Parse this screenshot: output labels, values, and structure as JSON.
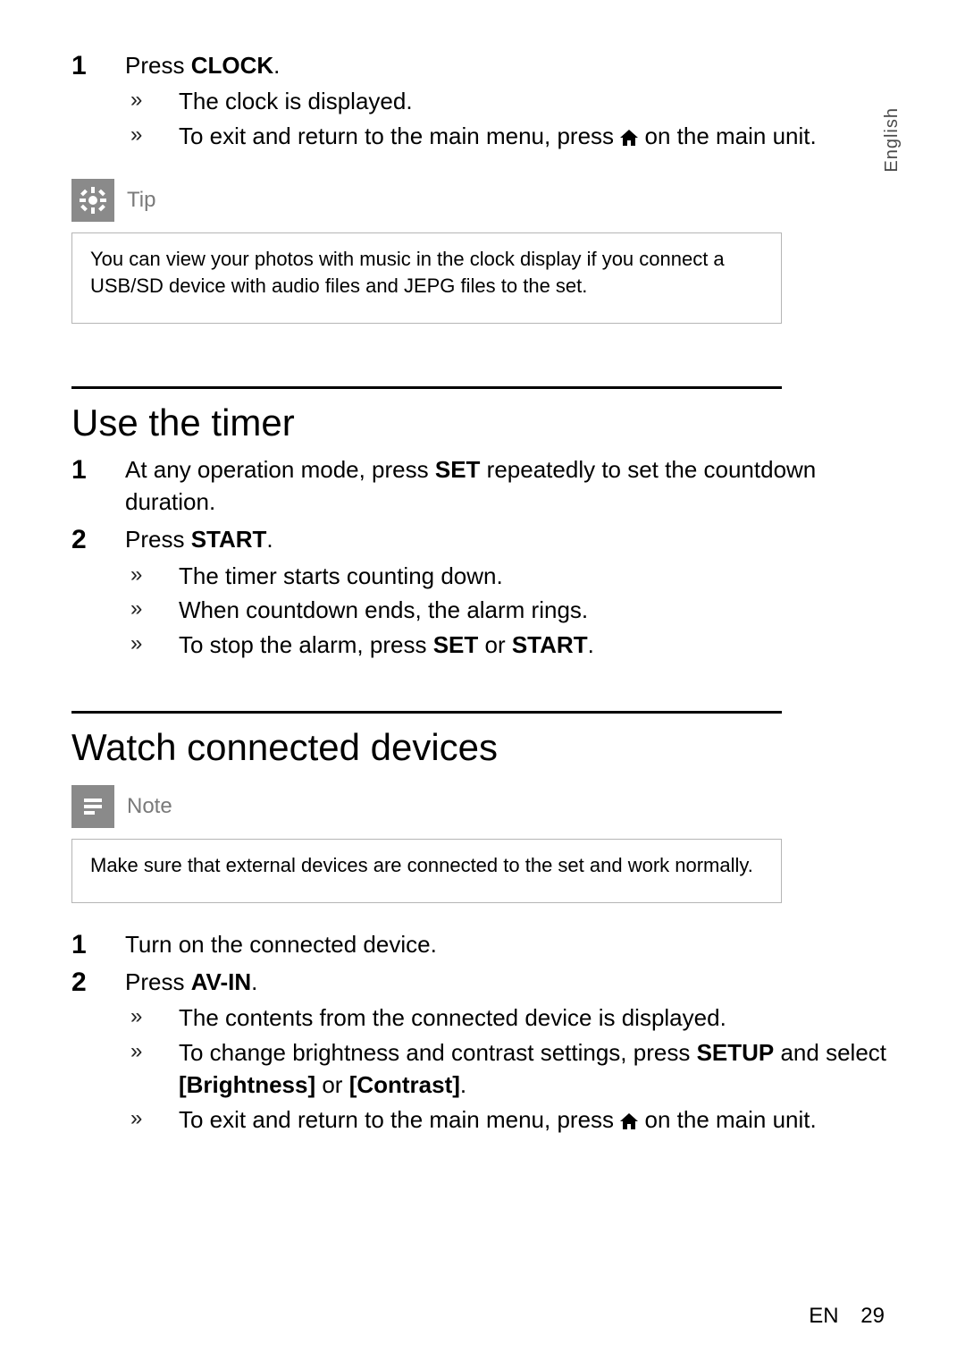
{
  "language_tab": "English",
  "section1": {
    "step1_num": "1",
    "step1_prefix": "Press ",
    "step1_key": "CLOCK",
    "step1_suffix": ".",
    "result1": "The clock is displayed.",
    "result2_a": "To exit and return to the main menu, press ",
    "result2_b": " on the main unit."
  },
  "tip": {
    "label": "Tip",
    "body": "You can view your photos with music in the clock display if you connect a USB/SD device with audio ﬁles and JEPG ﬁles to the set."
  },
  "timer": {
    "heading": "Use the timer",
    "step1_num": "1",
    "step1_a": "At any operation mode, press ",
    "step1_key": "SET",
    "step1_b": " repeatedly to set the countdown duration.",
    "step2_num": "2",
    "step2_prefix": "Press ",
    "step2_key": "START",
    "step2_suffix": ".",
    "r1": "The timer starts counting down.",
    "r2": "When countdown ends, the alarm rings.",
    "r3_a": "To stop the alarm, press ",
    "r3_key1": "SET",
    "r3_mid": " or ",
    "r3_key2": "START",
    "r3_end": "."
  },
  "watch": {
    "heading": "Watch connected devices",
    "note_label": "Note",
    "note_body": "Make sure that external devices are connected to the set and work normally.",
    "step1_num": "1",
    "step1": "Turn on the connected device.",
    "step2_num": "2",
    "step2_prefix": "Press ",
    "step2_key": "AV-IN",
    "step2_suffix": ".",
    "r1": "The contents from the connected device is displayed.",
    "r2_a": "To change brightness and contrast settings, press ",
    "r2_key": "SETUP",
    "r2_b": " and select ",
    "r2_opt1": "[Brightness]",
    "r2_mid": " or ",
    "r2_opt2": "[Contrast]",
    "r2_end": ".",
    "r3_a": "To exit and return to the main menu, press ",
    "r3_b": " on the main unit."
  },
  "footer": {
    "lang": "EN",
    "page": "29"
  }
}
